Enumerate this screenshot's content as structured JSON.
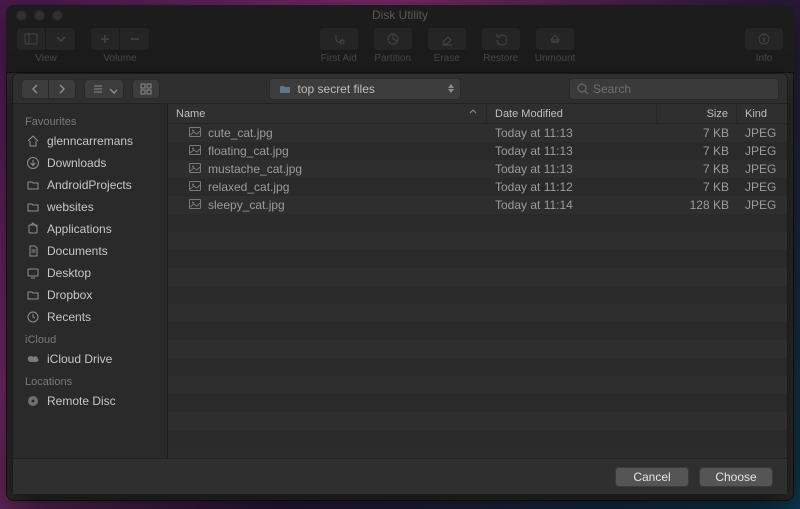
{
  "window": {
    "title": "Disk Utility"
  },
  "toolbar": {
    "view_label": "View",
    "volume_label": "Volume",
    "first_aid_label": "First Aid",
    "partition_label": "Partition",
    "erase_label": "Erase",
    "restore_label": "Restore",
    "unmount_label": "Unmount",
    "info_label": "Info"
  },
  "sheet": {
    "path_label": "top secret files",
    "search_placeholder": "Search",
    "sidebar": {
      "sections": [
        {
          "header": "Favourites",
          "items": [
            {
              "icon": "home-icon",
              "label": "glenncarremans"
            },
            {
              "icon": "download-icon",
              "label": "Downloads"
            },
            {
              "icon": "folder-icon",
              "label": "AndroidProjects"
            },
            {
              "icon": "folder-icon",
              "label": "websites"
            },
            {
              "icon": "apps-icon",
              "label": "Applications"
            },
            {
              "icon": "document-icon",
              "label": "Documents"
            },
            {
              "icon": "desktop-icon",
              "label": "Desktop"
            },
            {
              "icon": "folder-icon",
              "label": "Dropbox"
            },
            {
              "icon": "recents-icon",
              "label": "Recents"
            }
          ]
        },
        {
          "header": "iCloud",
          "items": [
            {
              "icon": "cloud-icon",
              "label": "iCloud Drive"
            }
          ]
        },
        {
          "header": "Locations",
          "items": [
            {
              "icon": "disc-icon",
              "label": "Remote Disc"
            }
          ]
        }
      ]
    },
    "columns": {
      "name": "Name",
      "date": "Date Modified",
      "size": "Size",
      "kind": "Kind"
    },
    "files": [
      {
        "name": "cute_cat.jpg",
        "date": "Today at 11:13",
        "size": "7 KB",
        "kind": "JPEG"
      },
      {
        "name": "floating_cat.jpg",
        "date": "Today at 11:13",
        "size": "7 KB",
        "kind": "JPEG"
      },
      {
        "name": "mustache_cat.jpg",
        "date": "Today at 11:13",
        "size": "7 KB",
        "kind": "JPEG"
      },
      {
        "name": "relaxed_cat.jpg",
        "date": "Today at 11:12",
        "size": "7 KB",
        "kind": "JPEG"
      },
      {
        "name": "sleepy_cat.jpg",
        "date": "Today at 11:14",
        "size": "128 KB",
        "kind": "JPEG"
      }
    ],
    "buttons": {
      "cancel": "Cancel",
      "choose": "Choose"
    }
  }
}
